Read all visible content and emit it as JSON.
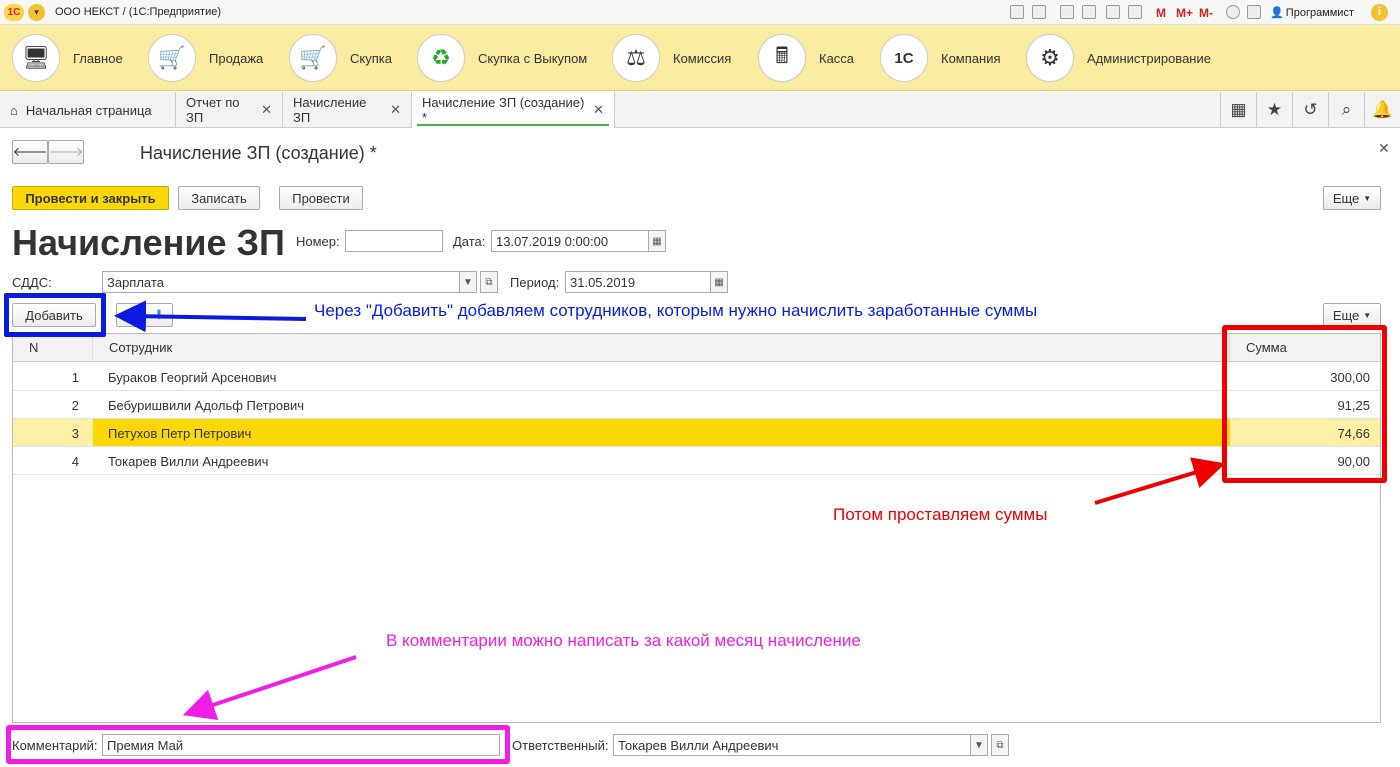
{
  "titlebar": {
    "logo": "1С",
    "app_title": "ООО НЕКСТ /   (1С:Предприятие)",
    "m_labels": [
      "M",
      "M+",
      "M-"
    ],
    "user": "Программист"
  },
  "sections": [
    {
      "label": "Главное",
      "icon": "computer-icon"
    },
    {
      "label": "Продажа",
      "icon": "cart-up-icon"
    },
    {
      "label": "Скупка",
      "icon": "cart-down-icon"
    },
    {
      "label": "Скупка с Выкупом",
      "icon": "recycle-icon"
    },
    {
      "label": "Комиссия",
      "icon": "scales-icon"
    },
    {
      "label": "Касса",
      "icon": "cash-register-icon"
    },
    {
      "label": "Компания",
      "icon": "1c-logo-icon"
    },
    {
      "label": "Администрирование",
      "icon": "gears-icon"
    }
  ],
  "tabs": [
    {
      "label": "Начальная страница"
    },
    {
      "label": "Отчет по ЗП"
    },
    {
      "label": "Начисление ЗП"
    },
    {
      "label": "Начисление ЗП (создание) *"
    }
  ],
  "form": {
    "window_title": "Начисление ЗП (создание) *",
    "heading": "Начисление ЗП",
    "btn_post_close": "Провести и закрыть",
    "btn_write": "Записать",
    "btn_post": "Провести",
    "btn_more": "Еще",
    "number_label": "Номер:",
    "number_value": "",
    "date_label": "Дата:",
    "date_value": "13.07.2019  0:00:00",
    "sdds_label": "СДДС:",
    "sdds_value": "Зарплата",
    "period_label": "Период:",
    "period_value": "31.05.2019",
    "btn_add": "Добавить",
    "btn_more_table": "Еще",
    "comment_label": "Комментарий:",
    "comment_value": "Премия Май",
    "responsible_label": "Ответственный:",
    "responsible_value": "Токарев Вилли Андреевич"
  },
  "table": {
    "headers": {
      "n": "N",
      "employee": "Сотрудник",
      "sum": "Сумма"
    },
    "rows": [
      {
        "n": "1",
        "employee": "Бураков Георгий Арсенович",
        "sum": "300,00"
      },
      {
        "n": "2",
        "employee": "Бебуришвили Адольф Петрович",
        "sum": "91,25"
      },
      {
        "n": "3",
        "employee": "Петухов Петр Петрович",
        "sum": "74,66"
      },
      {
        "n": "4",
        "employee": "Токарев Вилли Андреевич",
        "sum": "90,00"
      }
    ]
  },
  "annotations": {
    "blue": "Через \"Добавить\" добавляем сотрудников, которым нужно начислить заработанные суммы",
    "red": "Потом проставляем суммы",
    "magenta": "В комментарии можно написать за какой месяц начисление"
  },
  "colors": {
    "accent_yellow": "#fbd707",
    "section_bg": "#f9eba0",
    "annotation_blue": "#0a1be0",
    "annotation_red": "#ee0000",
    "annotation_magenta": "#f01ee6"
  }
}
